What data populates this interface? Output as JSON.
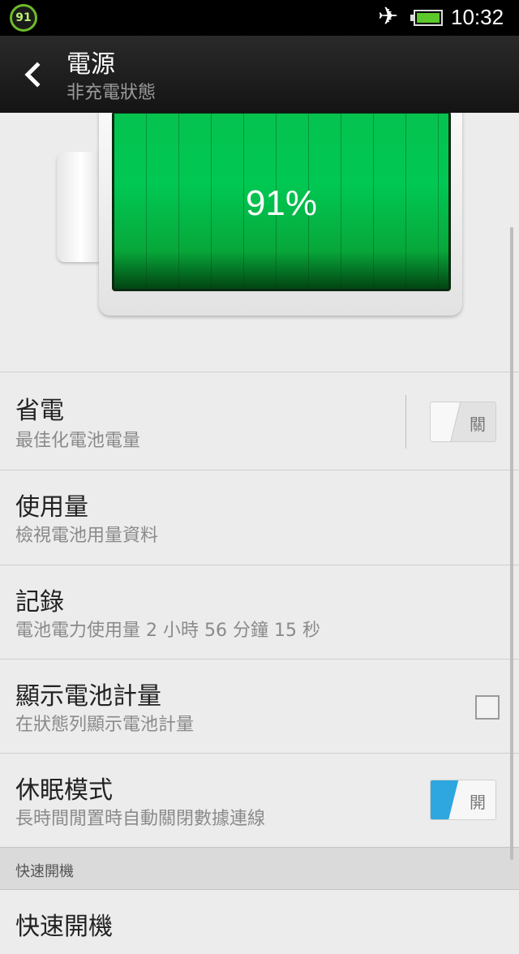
{
  "status_bar": {
    "badge_number": "91",
    "airplane_icon": "airplane-icon",
    "battery_icon": "battery-icon",
    "time": "10:32"
  },
  "action_bar": {
    "title": "電源",
    "subtitle": "非充電狀態"
  },
  "battery": {
    "percent_label": "91%",
    "level": 0.91
  },
  "items": {
    "power_saver": {
      "title": "省電",
      "subtitle": "最佳化電池電量",
      "toggle_label": "關",
      "on": false
    },
    "usage": {
      "title": "使用量",
      "subtitle": "檢視電池用量資料"
    },
    "history": {
      "title": "記錄",
      "subtitle": "電池電力使用量 2 小時 56 分鐘 15 秒"
    },
    "show_battery": {
      "title": "顯示電池計量",
      "subtitle": "在狀態列顯示電池計量",
      "checked": false
    },
    "sleep_mode": {
      "title": "休眠模式",
      "subtitle": "長時間閒置時自動關閉數據連線",
      "toggle_label": "開",
      "on": true
    }
  },
  "section": {
    "fast_boot_header": "快速開機",
    "fast_boot_title": "快速開機"
  },
  "colors": {
    "battery_green": "#00c853",
    "toggle_on": "#2ea7e0",
    "status_badge_green": "#6dbb2a"
  }
}
